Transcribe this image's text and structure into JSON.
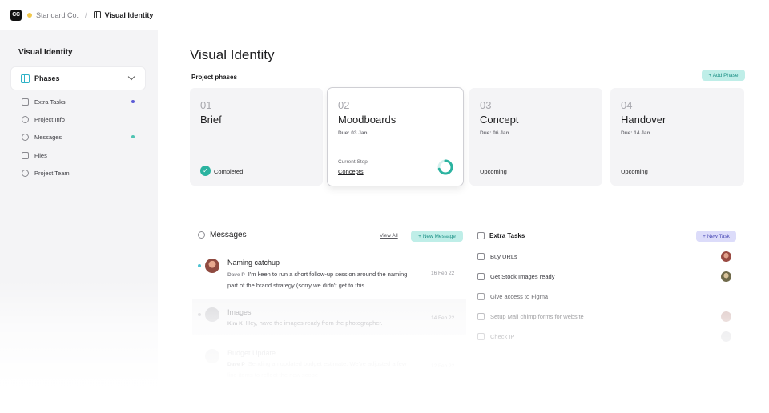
{
  "topbar": {
    "logo_text": "CC",
    "org_name": "Standard Co.",
    "separator": "/",
    "current": "Visual Identity"
  },
  "sidebar": {
    "title": "Visual Identity",
    "phases_label": "Phases",
    "items": [
      {
        "label": "Extra Tasks",
        "dot_color": "#5b5bd6"
      },
      {
        "label": "Project Info"
      },
      {
        "label": "Messages",
        "dot_color": "#4ec3b2"
      },
      {
        "label": "Files"
      },
      {
        "label": "Project Team"
      }
    ]
  },
  "main": {
    "title": "Visual Identity",
    "section_label": "Project phases",
    "add_phase": "+ Add Phase",
    "phases": [
      {
        "num": "01",
        "name": "Brief",
        "due": "",
        "status": "Completed"
      },
      {
        "num": "02",
        "name": "Moodboards",
        "due": "Due: 03 Jan",
        "step_label": "Current Step",
        "step_link": "Concepts",
        "progress": 0.7
      },
      {
        "num": "03",
        "name": "Concept",
        "due": "Due: 06 Jan",
        "status": "Upcoming"
      },
      {
        "num": "04",
        "name": "Handover",
        "due": "Due: 14 Jan",
        "status": "Upcoming"
      }
    ]
  },
  "messages": {
    "title": "Messages",
    "view_all": "View All",
    "new_message": "+ New Message",
    "items": [
      {
        "subject": "Naming catchup",
        "author": "Dave P",
        "body": "I'm keen to run a short follow-up session around the naming part of the brand strategy (sorry we didn't get to this",
        "date": "16 Feb 22",
        "unread": true
      },
      {
        "subject": "Images",
        "author": "Kim K",
        "body": "Hey, have the images ready from the photographer.",
        "date": "14 Feb 22",
        "unread": true
      },
      {
        "subject": "Budget Update",
        "author": "Dave P",
        "body": "Sending an updated budget estimate. We've adjusted a few line items to reflect the new scope",
        "date": "12 Feb 22",
        "unread": false
      }
    ]
  },
  "tasks": {
    "title": "Extra Tasks",
    "new_task": "+ New Task",
    "items": [
      {
        "label": "Buy URLs"
      },
      {
        "label": "Get Stock Images ready"
      },
      {
        "label": "Give access to Figma"
      },
      {
        "label": "Setup Mail chimp forms for website"
      },
      {
        "label": "Check IP"
      }
    ]
  }
}
